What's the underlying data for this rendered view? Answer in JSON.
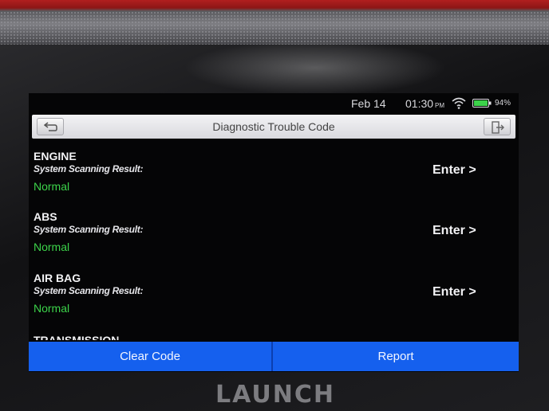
{
  "status_bar": {
    "date": "Feb 14",
    "time": "01:30",
    "ampm": "PM",
    "wifi_icon": "wifi-icon",
    "battery_icon": "battery-icon",
    "battery_percent": "94%"
  },
  "toolbar": {
    "title": "Diagnostic Trouble Code",
    "back_icon": "back-arrow-icon",
    "exit_icon": "exit-icon"
  },
  "systems": [
    {
      "name": "ENGINE",
      "label": "System Scanning Result:",
      "status": "Normal",
      "action": "Enter >"
    },
    {
      "name": "ABS",
      "label": "System Scanning Result:",
      "status": "Normal",
      "action": "Enter >"
    },
    {
      "name": "AIR BAG",
      "label": "System Scanning Result:",
      "status": "Normal",
      "action": "Enter >"
    },
    {
      "name": "TRANSMISSION"
    }
  ],
  "actions": {
    "clear_code": "Clear Code",
    "report": "Report"
  },
  "brand": "LAUNCH",
  "colors": {
    "status_normal": "#3cd34a",
    "action_bar": "#1560ee",
    "device_accent": "#b11f1f"
  }
}
